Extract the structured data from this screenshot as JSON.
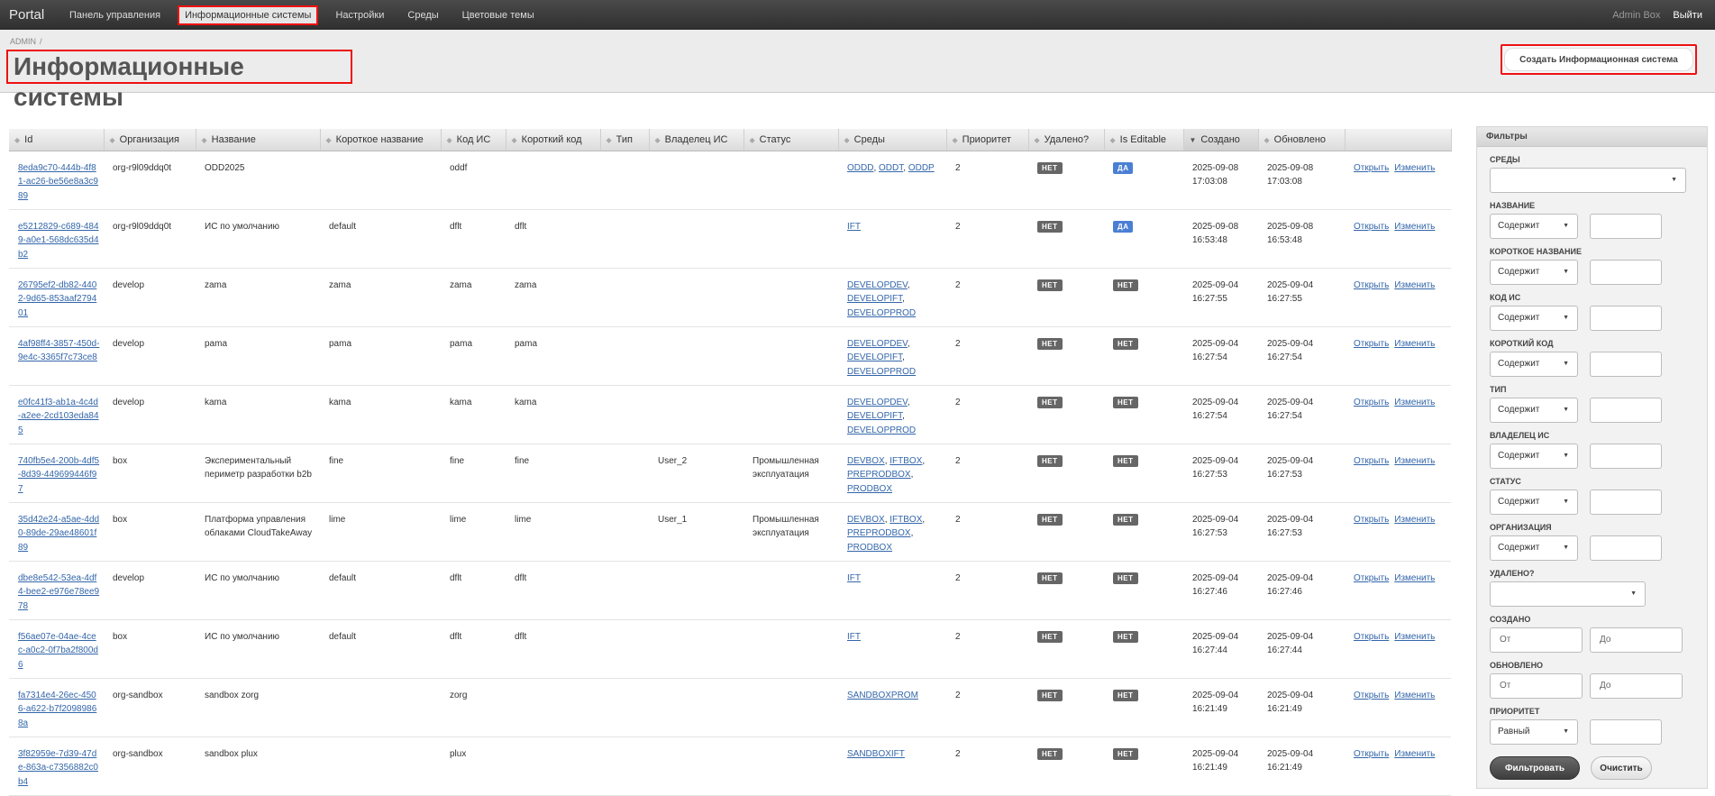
{
  "topbar": {
    "brand": "Portal",
    "nav": [
      "Панель управления",
      "Информационные системы",
      "Настройки",
      "Среды",
      "Цветовые темы"
    ],
    "user": "Admin Box",
    "logout": "Выйти"
  },
  "header": {
    "breadcrumb": "ADMIN",
    "breadcrumb_sep": "/",
    "title": "Информационные системы",
    "create_label": "Создать Информационная система"
  },
  "table": {
    "columns": [
      "Id",
      "Организация",
      "Название",
      "Короткое название",
      "Код ИС",
      "Короткий код",
      "Тип",
      "Владелец ИС",
      "Статус",
      "Среды",
      "Приоритет",
      "Удалено?",
      "Is Editable",
      "Создано",
      "Обновлено"
    ],
    "open_label": "Открыть",
    "edit_label": "Изменить",
    "rows": [
      {
        "id": "8eda9c70-444b-4f81-ac26-be56e8a3c989",
        "org": "org-r9l09ddq0t",
        "name": "ODD2025",
        "short_name": "",
        "code": "oddf",
        "short_code": "",
        "type": "",
        "owner": "",
        "status": "",
        "envs": [
          "ODDD",
          "ODDT",
          "ODDP"
        ],
        "priority": "2",
        "deleted": "НЕТ",
        "editable": "ДА",
        "created": [
          "2025-09-08",
          "17:03:08"
        ],
        "updated": [
          "2025-09-08",
          "17:03:08"
        ]
      },
      {
        "id": "e5212829-c689-4849-a0e1-568dc635d4b2",
        "org": "org-r9l09ddq0t",
        "name": "ИС по умолчанию",
        "short_name": "default",
        "code": "dflt",
        "short_code": "dflt",
        "type": "",
        "owner": "",
        "status": "",
        "envs": [
          "IFT"
        ],
        "priority": "2",
        "deleted": "НЕТ",
        "editable": "ДА",
        "created": [
          "2025-09-08",
          "16:53:48"
        ],
        "updated": [
          "2025-09-08",
          "16:53:48"
        ]
      },
      {
        "id": "26795ef2-db82-4402-9d65-853aaf279401",
        "org": "develop",
        "name": "zama",
        "short_name": "zama",
        "code": "zama",
        "short_code": "zama",
        "type": "",
        "owner": "",
        "status": "",
        "envs": [
          "DEVELOPDEV",
          "DEVELOPIFT",
          "DEVELOPPROD"
        ],
        "priority": "2",
        "deleted": "НЕТ",
        "editable": "НЕТ",
        "created": [
          "2025-09-04",
          "16:27:55"
        ],
        "updated": [
          "2025-09-04",
          "16:27:55"
        ]
      },
      {
        "id": "4af98ff4-3857-450d-9e4c-3365f7c73ce8",
        "org": "develop",
        "name": "pama",
        "short_name": "pama",
        "code": "pama",
        "short_code": "pama",
        "type": "",
        "owner": "",
        "status": "",
        "envs": [
          "DEVELOPDEV",
          "DEVELOPIFT",
          "DEVELOPPROD"
        ],
        "priority": "2",
        "deleted": "НЕТ",
        "editable": "НЕТ",
        "created": [
          "2025-09-04",
          "16:27:54"
        ],
        "updated": [
          "2025-09-04",
          "16:27:54"
        ]
      },
      {
        "id": "e0fc41f3-ab1a-4c4d-a2ee-2cd103eda845",
        "org": "develop",
        "name": "kama",
        "short_name": "kama",
        "code": "kama",
        "short_code": "kama",
        "type": "",
        "owner": "",
        "status": "",
        "envs": [
          "DEVELOPDEV",
          "DEVELOPIFT",
          "DEVELOPPROD"
        ],
        "priority": "2",
        "deleted": "НЕТ",
        "editable": "НЕТ",
        "created": [
          "2025-09-04",
          "16:27:54"
        ],
        "updated": [
          "2025-09-04",
          "16:27:54"
        ]
      },
      {
        "id": "740fb5e4-200b-4df5-8d39-449699446f97",
        "org": "box",
        "name": "Экспериментальный периметр разработки b2b",
        "short_name": "fine",
        "code": "fine",
        "short_code": "fine",
        "type": "",
        "owner": "User_2",
        "status": "Промышленная эксплуатация",
        "envs": [
          "DEVBOX",
          "IFTBOX",
          "PREPRODBOX",
          "PRODBOX"
        ],
        "priority": "2",
        "deleted": "НЕТ",
        "editable": "НЕТ",
        "created": [
          "2025-09-04",
          "16:27:53"
        ],
        "updated": [
          "2025-09-04",
          "16:27:53"
        ]
      },
      {
        "id": "35d42e24-a5ae-4dd0-89de-29ae48601f89",
        "org": "box",
        "name": "Платформа управления облаками CloudTakeAway",
        "short_name": "lime",
        "code": "lime",
        "short_code": "lime",
        "type": "",
        "owner": "User_1",
        "status": "Промышленная эксплуатация",
        "envs": [
          "DEVBOX",
          "IFTBOX",
          "PREPRODBOX",
          "PRODBOX"
        ],
        "priority": "2",
        "deleted": "НЕТ",
        "editable": "НЕТ",
        "created": [
          "2025-09-04",
          "16:27:53"
        ],
        "updated": [
          "2025-09-04",
          "16:27:53"
        ]
      },
      {
        "id": "dbe8e542-53ea-4df4-bee2-e976e78ee978",
        "org": "develop",
        "name": "ИС по умолчанию",
        "short_name": "default",
        "code": "dflt",
        "short_code": "dflt",
        "type": "",
        "owner": "",
        "status": "",
        "envs": [
          "IFT"
        ],
        "priority": "2",
        "deleted": "НЕТ",
        "editable": "НЕТ",
        "created": [
          "2025-09-04",
          "16:27:46"
        ],
        "updated": [
          "2025-09-04",
          "16:27:46"
        ]
      },
      {
        "id": "f56ae07e-04ae-4cec-a0c2-0f7ba2f800d6",
        "org": "box",
        "name": "ИС по умолчанию",
        "short_name": "default",
        "code": "dflt",
        "short_code": "dflt",
        "type": "",
        "owner": "",
        "status": "",
        "envs": [
          "IFT"
        ],
        "priority": "2",
        "deleted": "НЕТ",
        "editable": "НЕТ",
        "created": [
          "2025-09-04",
          "16:27:44"
        ],
        "updated": [
          "2025-09-04",
          "16:27:44"
        ]
      },
      {
        "id": "fa7314e4-26ec-4506-a622-b7f20989868a",
        "org": "org-sandbox",
        "name": "sandbox zorg",
        "short_name": "",
        "code": "zorg",
        "short_code": "",
        "type": "",
        "owner": "",
        "status": "",
        "envs": [
          "SANDBOXPROM"
        ],
        "priority": "2",
        "deleted": "НЕТ",
        "editable": "НЕТ",
        "created": [
          "2025-09-04",
          "16:21:49"
        ],
        "updated": [
          "2025-09-04",
          "16:21:49"
        ]
      },
      {
        "id": "3f82959e-7d39-47de-863a-c7356882c0b4",
        "org": "org-sandbox",
        "name": "sandbox plux",
        "short_name": "",
        "code": "plux",
        "short_code": "",
        "type": "",
        "owner": "",
        "status": "",
        "envs": [
          "SANDBOXIFT"
        ],
        "priority": "2",
        "deleted": "НЕТ",
        "editable": "НЕТ",
        "created": [
          "2025-09-04",
          "16:21:49"
        ],
        "updated": [
          "2025-09-04",
          "16:21:49"
        ]
      }
    ]
  },
  "filters": {
    "title": "Фильтры",
    "contains": "Содержит",
    "equal": "Равный",
    "from": "От",
    "to": "До",
    "labels": {
      "envs": "Среды",
      "name": "Название",
      "short_name": "Короткое название",
      "code": "Код ИС",
      "short_code": "Короткий код",
      "type": "Тип",
      "owner": "Владелец ИС",
      "status": "Статус",
      "org": "Организация",
      "deleted": "Удалено?",
      "created": "Создано",
      "updated": "Обновлено",
      "priority": "Приоритет"
    },
    "filter_button": "Фильтровать",
    "clear_button": "Очистить"
  },
  "icons": {
    "dropdown": "chevron-down-icon",
    "sort": "sort-icon"
  },
  "colors": {
    "highlight": "#ee1111",
    "badge_no": "#666666",
    "badge_yes": "#4a7fd4",
    "link": "#3366aa"
  }
}
